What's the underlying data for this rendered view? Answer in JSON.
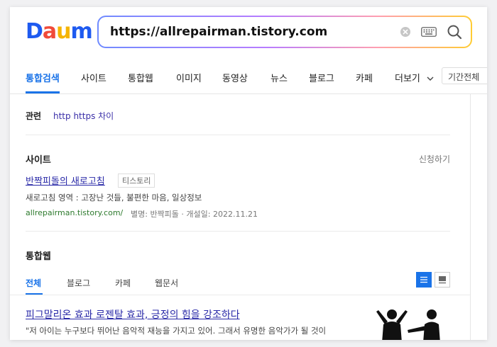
{
  "logo": {
    "letters": [
      "D",
      "a",
      "u",
      "m"
    ],
    "colors": [
      "#1e5af0",
      "#f04b3a",
      "#f5b400",
      "#1e5af0"
    ]
  },
  "search": {
    "query": "https://allrepairman.tistory.com",
    "clear_icon": "clear-icon",
    "keyboard_icon": "keyboard-icon",
    "search_icon": "search-icon"
  },
  "nav": {
    "tabs": [
      {
        "label": "통합검색",
        "active": true
      },
      {
        "label": "사이트"
      },
      {
        "label": "통합웹"
      },
      {
        "label": "이미지"
      },
      {
        "label": "동영상"
      },
      {
        "label": "뉴스"
      },
      {
        "label": "블로그"
      },
      {
        "label": "카페"
      }
    ],
    "more_label": "더보기",
    "period_label": "기간전체"
  },
  "related": {
    "label": "관련",
    "link": "http https 차이"
  },
  "site_section": {
    "title": "사이트",
    "apply_label": "신청하기",
    "result": {
      "title": "반짝피돌의 새로고침",
      "badge": "티스토리",
      "description": "새로고침 영역 : 고장난 것들, 불편한 마음, 일상정보",
      "url": "allrepairman.tistory.com/",
      "meta": "별명: 반짝피돌 · 개설일: 2022.11.21"
    }
  },
  "web_section": {
    "title": "통합웹",
    "subtabs": [
      {
        "label": "전체",
        "active": true
      },
      {
        "label": "블로그"
      },
      {
        "label": "카페"
      },
      {
        "label": "웹문서"
      }
    ],
    "result": {
      "title": "피그말리온 효과 로젠탈 효과, 긍정의 힘을 강조하다",
      "snippet": "\"저 아이는 누구보다 뛰어난 음악적 재능을 가지고 있어. 그래서 유명한 음악가가 될 것이"
    }
  },
  "colors": {
    "accent": "#1a73e8",
    "link": "#2a2aa8",
    "url": "#2d7a2d"
  }
}
